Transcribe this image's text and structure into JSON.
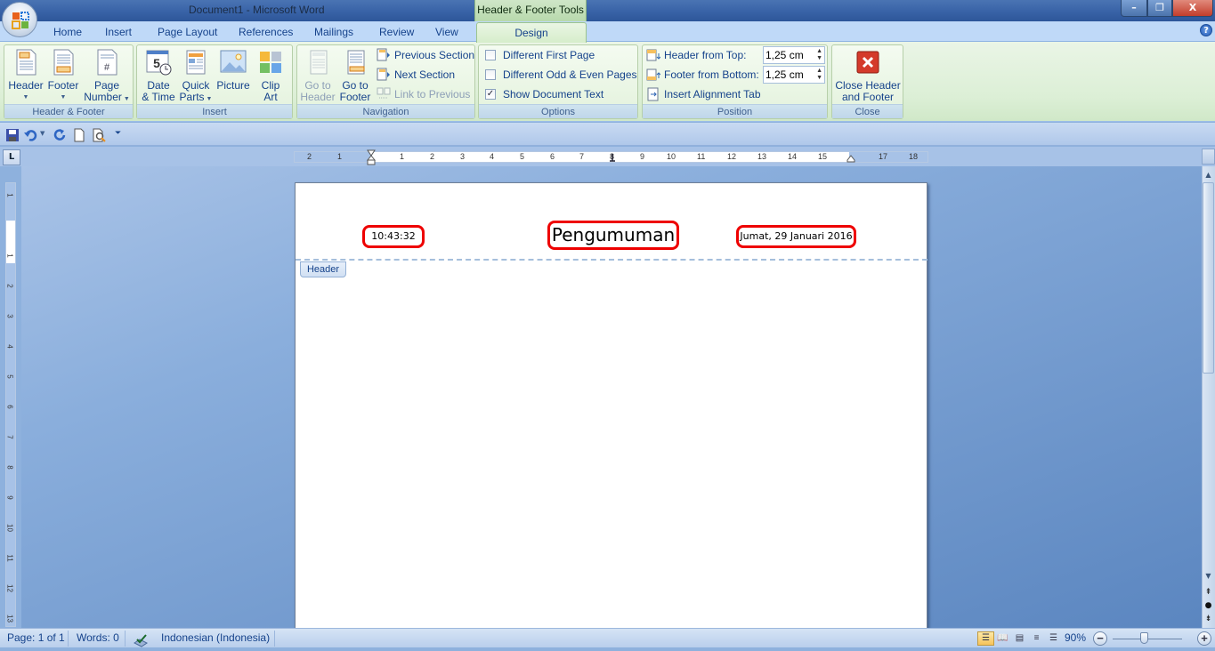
{
  "window": {
    "title": "Document1 - Microsoft Word",
    "contextual_tab_title": "Header & Footer Tools",
    "minimize_label": "–",
    "restore_label": "❐",
    "close_label": "X"
  },
  "tabs": [
    {
      "label": "Home"
    },
    {
      "label": "Insert"
    },
    {
      "label": "Page Layout"
    },
    {
      "label": "References"
    },
    {
      "label": "Mailings"
    },
    {
      "label": "Review"
    },
    {
      "label": "View"
    },
    {
      "label": "Design",
      "active": true
    }
  ],
  "help_label": "?",
  "ribbon": {
    "header_footer": {
      "label": "Header & Footer",
      "header": "Header",
      "footer": "Footer",
      "page_number_line1": "Page",
      "page_number_line2": "Number"
    },
    "insert": {
      "label": "Insert",
      "date_time_line1": "Date",
      "date_time_line2": "& Time",
      "quick_parts_line1": "Quick",
      "quick_parts_line2": "Parts",
      "picture": "Picture",
      "clip_art_line1": "Clip",
      "clip_art_line2": "Art"
    },
    "navigation": {
      "label": "Navigation",
      "go_to_header_line1": "Go to",
      "go_to_header_line2": "Header",
      "go_to_footer_line1": "Go to",
      "go_to_footer_line2": "Footer",
      "previous_section": "Previous Section",
      "next_section": "Next Section",
      "link_to_previous": "Link to Previous"
    },
    "options": {
      "label": "Options",
      "different_first_page": "Different First Page",
      "different_first_page_checked": false,
      "different_odd_even": "Different Odd & Even Pages",
      "different_odd_even_checked": false,
      "show_document_text": "Show Document Text",
      "show_document_text_checked": true,
      "check_mark": "✓"
    },
    "position": {
      "label": "Position",
      "header_from_top_label": "Header from Top:",
      "header_from_top_value": "1,25 cm",
      "footer_from_bottom_label": "Footer from Bottom:",
      "footer_from_bottom_value": "1,25 cm",
      "insert_alignment_tab": "Insert Alignment Tab",
      "spin_arrows": "▲\n▼"
    },
    "close": {
      "label": "Close",
      "close_line1": "Close Header",
      "close_line2": "and Footer"
    }
  },
  "ruler": {
    "tab_selector": "L",
    "horizontal_numbers": [
      "2",
      "1",
      "1",
      "2",
      "3",
      "4",
      "5",
      "6",
      "7",
      "8",
      "9",
      "10",
      "11",
      "12",
      "13",
      "14",
      "15",
      "17",
      "18"
    ],
    "vertical_numbers": [
      "1",
      "1",
      "2",
      "3",
      "4",
      "5",
      "6",
      "7",
      "8",
      "9",
      "10",
      "11",
      "12",
      "13"
    ]
  },
  "document": {
    "header_tag": "Header",
    "header_time": "10:43:32",
    "header_title": "Pengumuman",
    "header_date": "Jumat, 29 Januari 2016"
  },
  "statusbar": {
    "page": "Page: 1 of 1",
    "words": "Words: 0",
    "language": "Indonesian (Indonesia)",
    "zoom_percent": "90%",
    "zoom_value": 90,
    "zoom_minus": "−",
    "zoom_plus": "+"
  }
}
